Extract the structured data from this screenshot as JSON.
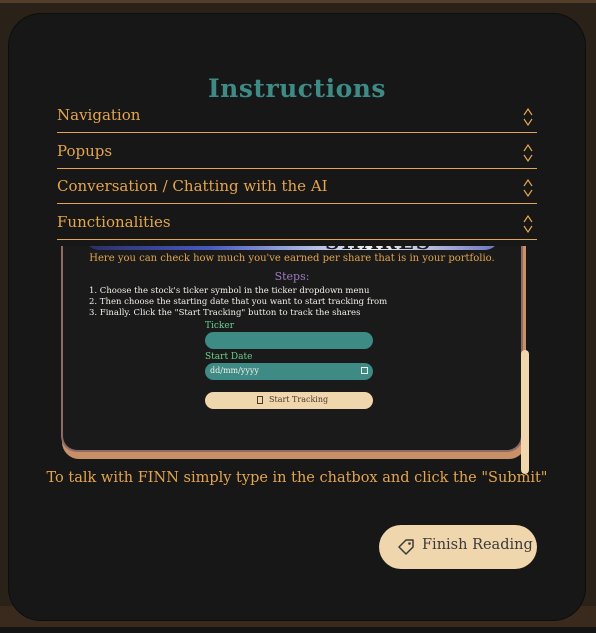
{
  "modal": {
    "title": "Instructions",
    "accordions": [
      {
        "label": "Navigation",
        "icon": "up-down-chevron-icon"
      },
      {
        "label": "Popups",
        "icon": "up-down-chevron-icon"
      },
      {
        "label": "Conversation / Chatting with the AI",
        "icon": "up-down-chevron-icon"
      },
      {
        "label": "Functionalities",
        "icon": "up-down-chevron-icon"
      }
    ],
    "screenshot": {
      "banner_text": "SHARES",
      "intro": "Here you can check how much you've earned per share that is in your portfolio.",
      "steps_title": "Steps:",
      "steps": [
        "1. Choose the stock's ticker symbol in the ticker dropdown menu",
        "2. Then choose the starting date that you want to start tracking from",
        "3. Finally. Click the \"Start Tracking\" button to track the shares"
      ],
      "ticker_label": "Ticker",
      "start_date_label": "Start Date",
      "start_date_placeholder": "dd/mm/yyyy",
      "start_tracking_label": "Start Tracking"
    },
    "chat_instruction": "To talk with FINN simply type in the chatbox and click the \"Submit\"",
    "finish_button": {
      "label": "Finish Reading",
      "icon": "tag-icon"
    },
    "colors": {
      "accent": "#e3a54f",
      "teal": "#3e8b86",
      "cream": "#f0d6ad",
      "background": "#171717"
    }
  }
}
